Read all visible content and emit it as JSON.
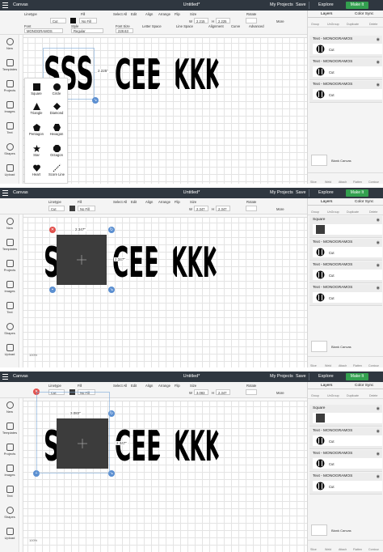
{
  "app": {
    "canvas_label": "Canvas",
    "doc_title": "Untitled*",
    "my_projects": "My Projects",
    "save": "Save",
    "explore": "Explore",
    "make_it": "Make It"
  },
  "toolbar": {
    "linetype_label": "Linetype",
    "linetype_value": "Cut",
    "fill_label": "Fill",
    "fill_value": "No Fill",
    "select_all": "Select All",
    "edit": "Edit",
    "align": "Align",
    "arrange": "Arrange",
    "flip": "Flip",
    "size": "Size",
    "size_w_label": "W",
    "size_h_label": "H",
    "rotate": "Rotate",
    "more": "More",
    "font_label": "Font",
    "font_value": "MONOGRAMOS",
    "style_label": "Style",
    "style_value": "Regular",
    "font_size": "Font Size",
    "font_size_value": "228.63",
    "letter_space": "Letter Space",
    "line_space": "Line Space",
    "alignment": "Alignment",
    "curve": "Curve",
    "advanced": "Advanced",
    "p1_w": "2.215",
    "p1_h": "2.225",
    "p2_w": "2.347",
    "p2_h": "2.347",
    "p3_w": "3.083",
    "p3_h": "2.347"
  },
  "left_nav": [
    "New",
    "Templates",
    "Projects",
    "Images",
    "Text",
    "Shapes",
    "Upload"
  ],
  "right_panel": {
    "tab_layers": "Layers",
    "tab_color_sync": "Color Sync",
    "top_actions": [
      "Group",
      "UnGroup",
      "Duplicate",
      "Delete"
    ],
    "bottom_actions": [
      "Slice",
      "Weld",
      "Attach",
      "Flatten",
      "Contour"
    ],
    "blank_canvas": "Blank Canvas",
    "cut": "Cut",
    "layer_text": "Text - MONOGRAMOS",
    "layer_square": "Square"
  },
  "shapes_menu": [
    "Square",
    "Circle",
    "Triangle",
    "Diamond",
    "Pentagon",
    "Hexagon",
    "Star",
    "Octagon",
    "Heart",
    "Score Line"
  ],
  "canvas": {
    "monogram_1": "SSS",
    "monogram_2": "CEE",
    "monogram_3": "KKK",
    "zoom": "100%",
    "dim_p1_right": "2.225\"",
    "dim_p2_top": "2.347\"",
    "dim_p2_right": "2.347\"",
    "dim_p3_top": "3.083\"",
    "dim_p3_right": "2.347\""
  },
  "colors": {
    "titlebar": "#2f3740",
    "make_it": "#33a04f",
    "delete_handle": "#e2504c",
    "handle_blue": "#5b8fd1",
    "square_fill": "#3c3c3c"
  }
}
